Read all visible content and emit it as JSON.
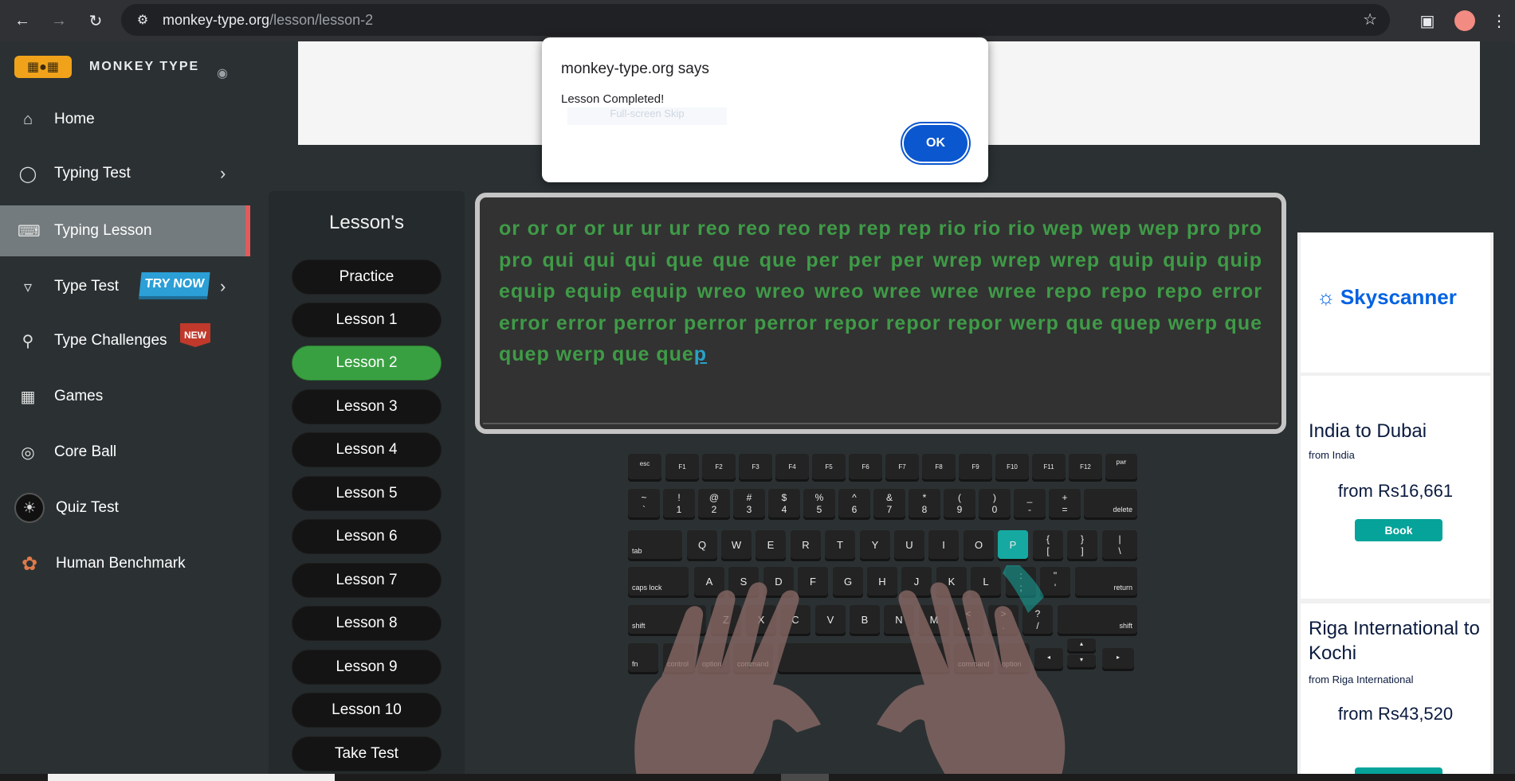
{
  "browser": {
    "url_host": "monkey-type.org",
    "url_path": "/lesson/lesson-2"
  },
  "sidebar": {
    "logo_text": "MONKEY TYPE",
    "items": [
      {
        "label": "Home",
        "icon": "home-icon"
      },
      {
        "label": "Typing Test",
        "icon": "github-icon"
      },
      {
        "label": "Typing Lesson",
        "icon": "keyboard-icon"
      },
      {
        "label": "Type Test",
        "icon": "gitlab-icon",
        "badge": "TRY NOW"
      },
      {
        "label": "Type Challenges",
        "icon": "award-icon",
        "badge": "NEW"
      },
      {
        "label": "Games",
        "icon": "grid-icon"
      },
      {
        "label": "Core Ball",
        "icon": "target-icon"
      },
      {
        "label": "Quiz Test",
        "icon": "bulb-avatar-icon"
      },
      {
        "label": "Human Benchmark",
        "icon": "brain-avatar-icon"
      }
    ]
  },
  "lessons": {
    "title": "Lesson's",
    "buttons": [
      "Practice",
      "Lesson 1",
      "Lesson 2",
      "Lesson 3",
      "Lesson 4",
      "Lesson 5",
      "Lesson 6",
      "Lesson 7",
      "Lesson 8",
      "Lesson 9",
      "Lesson 10",
      "Take Test"
    ],
    "active": "Lesson 2"
  },
  "typing": {
    "typed_text": "or or or or ur ur ur reo reo reo rep rep rep rio rio rio wep wep wep pro pro pro qui qui qui que que que per per per wrep wrep wrep quip quip quip equip equip equip wreo wreo wreo wree wree wree repo repo repo error error error perror perror perror repor repor repor werp que quep werp que quep werp que que",
    "current_char": "p"
  },
  "keyboard": {
    "highlighted_key": "P",
    "row0": [
      "esc",
      "F1",
      "F2",
      "F3",
      "F4",
      "F5",
      "F6",
      "F7",
      "F8",
      "F9",
      "F10",
      "F11",
      "F12",
      "pwr"
    ],
    "row1": [
      [
        "~",
        "`"
      ],
      [
        "!",
        "1"
      ],
      [
        "@",
        "2"
      ],
      [
        "#",
        "3"
      ],
      [
        "$",
        "4"
      ],
      [
        "%",
        "5"
      ],
      [
        "^",
        "6"
      ],
      [
        "&",
        "7"
      ],
      [
        "*",
        "8"
      ],
      [
        "(",
        "9"
      ],
      [
        ")",
        "0"
      ],
      [
        "_",
        "-"
      ],
      [
        "+",
        "="
      ]
    ],
    "delete": "delete",
    "tab": "tab",
    "row2": [
      "Q",
      "W",
      "E",
      "R",
      "T",
      "Y",
      "U",
      "I",
      "O",
      "P"
    ],
    "row2_sym": [
      [
        "{",
        "["
      ],
      [
        "}",
        "]"
      ],
      [
        "|",
        "\\"
      ]
    ],
    "caps": "caps lock",
    "row3": [
      "A",
      "S",
      "D",
      "F",
      "G",
      "H",
      "J",
      "K",
      "L"
    ],
    "row3_sym": [
      [
        ":",
        ";"
      ],
      [
        "\"",
        "'"
      ]
    ],
    "return": "return",
    "shift": "shift",
    "row4": [
      "Z",
      "X",
      "C",
      "V",
      "B",
      "N",
      "M"
    ],
    "row4_sym": [
      [
        "<",
        ","
      ],
      [
        ">",
        "."
      ],
      [
        "?",
        "/"
      ]
    ],
    "fn": "fn",
    "control": "control",
    "option": "option",
    "command": "command",
    "arrows": [
      "◂",
      "▴",
      "▾",
      "▸"
    ]
  },
  "ad": {
    "brand": "Skyscanner",
    "card1_title": "India to Dubai",
    "card1_from": "from India",
    "card1_price": "from Rs16,661",
    "card2_title": "Riga International to Kochi",
    "card2_from": "from Riga International",
    "card2_price": "from Rs43,520",
    "book_label": "Book"
  },
  "dialog": {
    "title": "monkey-type.org says",
    "message": "Lesson Completed!",
    "ghost_text": "Full-screen Skip",
    "ok_label": "OK"
  },
  "colors": {
    "typed_text": "#3f9b47",
    "active_lesson": "#39a041",
    "active_nav_bar": "#e25a5a",
    "highlight_key": "#16a9a1",
    "ok_button": "#0b57d0"
  }
}
